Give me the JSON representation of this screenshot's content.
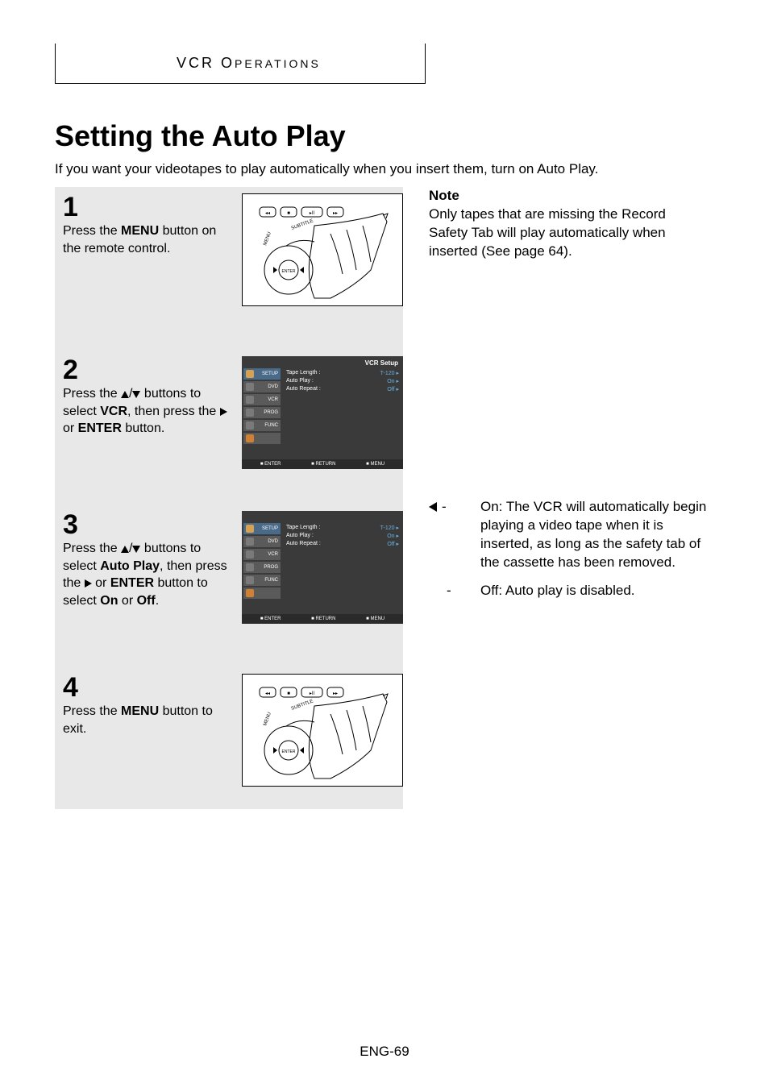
{
  "header": {
    "part1": "VCR O",
    "part2": "PERATIONS"
  },
  "title": "Setting the Auto Play",
  "intro": "If you want your videotapes to play automatically when you insert them, turn on Auto Play.",
  "steps": [
    {
      "num": "1",
      "text_before": "Press the ",
      "bold1": "MENU",
      "text_mid": " button on the remote control.",
      "img": "remote"
    },
    {
      "num": "2",
      "text_before": "Press the ",
      "arrows": "updown",
      "text_mid": " buttons to select ",
      "bold1": "VCR",
      "text_after": ", then press the ",
      "arrow_r": true,
      "text_end": " or ",
      "bold2": "ENTER",
      "text_final": " button.",
      "img": "menu1"
    },
    {
      "num": "3",
      "text_before": "Press the ",
      "arrows": "updown",
      "text_mid": " buttons to select ",
      "bold1": "Auto Play",
      "text_after": ", then press the ",
      "arrow_r": true,
      "text_end": " or ",
      "bold2": "ENTER",
      "text_final": " button to select ",
      "bold3": "On",
      "text_or": " or ",
      "bold4": "Off",
      "text_period": ".",
      "img": "menu2"
    },
    {
      "num": "4",
      "text_before": "Press the ",
      "bold1": "MENU",
      "text_mid": " button to exit.",
      "img": "remote"
    }
  ],
  "note": {
    "label": "Note",
    "text": "Only tapes that are missing the Record Safety Tab will play automatically when inserted (See page 64)."
  },
  "menu_screen": {
    "title": "VCR Setup",
    "side": [
      "SETUP",
      "DVD",
      "VCR",
      "PROG",
      "FUNC"
    ],
    "rows": [
      {
        "label": "Tape Length :",
        "value": "T-120"
      },
      {
        "label": "Auto Play :",
        "value": "On"
      },
      {
        "label": "Auto Repeat :",
        "value": "Off"
      }
    ],
    "footer": [
      "ENTER",
      "RETURN",
      "MENU"
    ]
  },
  "bullets": [
    {
      "lead_arrow": true,
      "dash": "-",
      "label": "On:",
      "text": " The VCR will automatically begin playing a video tape when it is inserted, as long as the safety tab of the cassette has been removed."
    },
    {
      "lead_arrow": false,
      "dash": "-",
      "label": "Off:",
      "text": " Auto play is disabled."
    }
  ],
  "pagenum": "ENG-69",
  "remote_labels": {
    "rewind": "◂◂",
    "stop": "■",
    "playpause": "▸II",
    "ffwd": "▸▸",
    "subtitle": "SUBTITLE",
    "menu": "MENU",
    "enter": "ENTER"
  }
}
